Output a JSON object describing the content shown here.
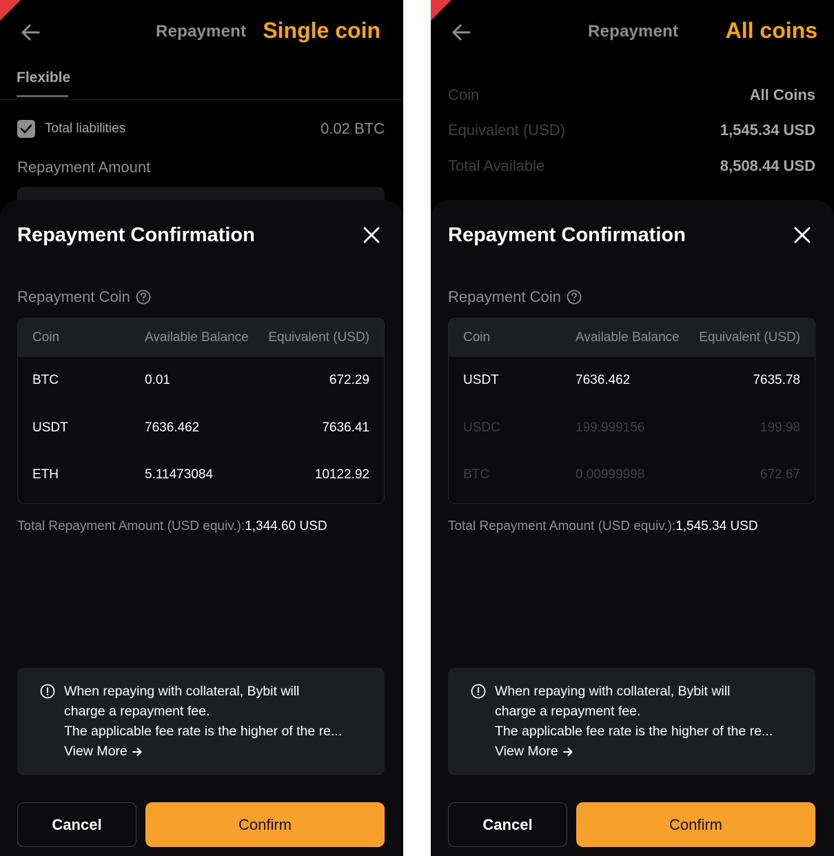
{
  "colors": {
    "accent": "#f7a600",
    "confirm_button": "#f7a12a",
    "corner_mark": "#e5383b",
    "sheet_bg": "#0c0c0e"
  },
  "left_panel": {
    "header": {
      "title": "Repayment",
      "annotation": "Single coin",
      "back_icon": "arrow-left-icon"
    },
    "tab": "Flexible",
    "liabilities_label": "Total liabilities",
    "liabilities_value": "0.02 BTC",
    "repayment_amount_label": "Repayment Amount",
    "sheet": {
      "title": "Repayment Confirmation",
      "section_label": "Repayment Coin",
      "columns": [
        "Coin",
        "Available Balance",
        "Equivalent (USD)"
      ],
      "rows": [
        {
          "coin": "BTC",
          "balance": "0.01",
          "usd": "672.29"
        },
        {
          "coin": "USDT",
          "balance": "7636.462",
          "usd": "7636.41"
        },
        {
          "coin": "ETH",
          "balance": "5.11473084",
          "usd": "10122.92"
        }
      ],
      "total_label": "Total Repayment Amount (USD equiv.):",
      "total_value": "1,344.60 USD",
      "notice": {
        "line1": "When repaying with collateral, Bybit will",
        "line2": "charge a repayment fee.",
        "line3": "The applicable fee rate is the higher of the re...",
        "view_more": "View More"
      },
      "cancel_label": "Cancel",
      "confirm_label": "Confirm"
    }
  },
  "right_panel": {
    "header": {
      "title": "Repayment",
      "annotation": "All coins",
      "back_icon": "arrow-left-icon"
    },
    "bg_rows": [
      {
        "label": "Coin",
        "value": "All Coins"
      },
      {
        "label": "Equivalent (USD)",
        "value": "1,545.34 USD"
      },
      {
        "label": "Total Available",
        "value": "8,508.44 USD"
      }
    ],
    "sheet": {
      "title": "Repayment Confirmation",
      "section_label": "Repayment Coin",
      "columns": [
        "Coin",
        "Available Balance",
        "Equivalent (USD)"
      ],
      "rows": [
        {
          "coin": "USDT",
          "balance": "7636.462",
          "usd": "7635.78"
        },
        {
          "coin": "USDC",
          "balance": "199.999156",
          "usd": "199.98"
        },
        {
          "coin": "BTC",
          "balance": "0.00999998",
          "usd": "672.67"
        }
      ],
      "total_label": "Total Repayment Amount (USD equiv.):",
      "total_value": "1,545.34 USD",
      "notice": {
        "line1": "When repaying with collateral, Bybit will",
        "line2": "charge a repayment fee.",
        "line3": "The applicable fee rate is the higher of the re...",
        "view_more": "View More"
      },
      "cancel_label": "Cancel",
      "confirm_label": "Confirm"
    }
  }
}
